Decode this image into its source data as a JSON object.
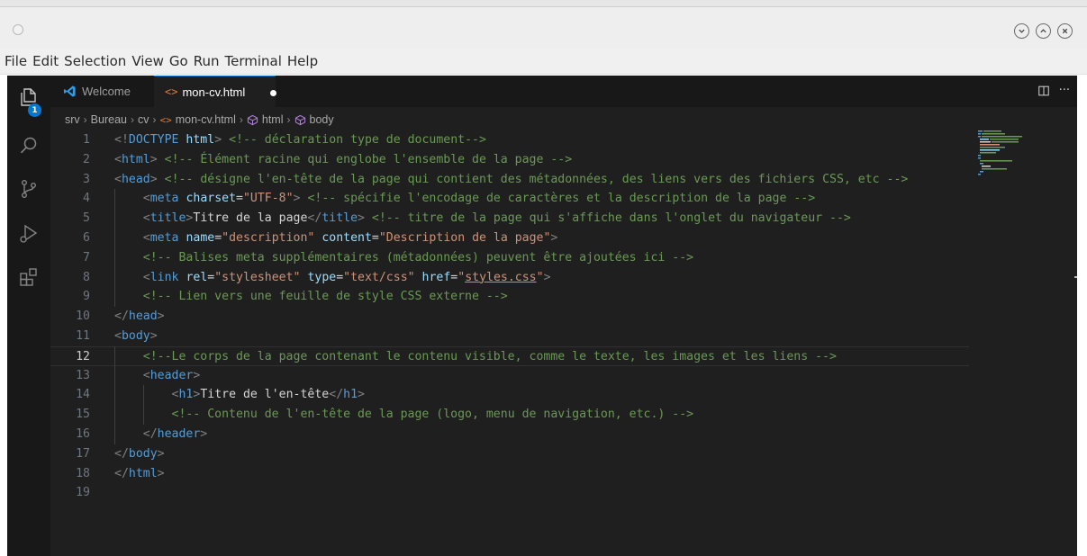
{
  "menubar": {
    "items": [
      "File",
      "Edit",
      "Selection",
      "View",
      "Go",
      "Run",
      "Terminal",
      "Help"
    ]
  },
  "window_controls": {
    "icons": [
      "minimize-icon",
      "maximize-icon",
      "close-icon"
    ]
  },
  "activity_bar": {
    "icons": [
      "explorer-icon",
      "search-icon",
      "source-control-icon",
      "run-debug-icon",
      "extensions-icon"
    ],
    "explorer_badge": "1"
  },
  "tabs": [
    {
      "label": "Welcome",
      "icon": "vscode-logo-icon",
      "active": false
    },
    {
      "label": "mon-cv.html",
      "icon": "html-file-icon",
      "active": true,
      "modified": true
    }
  ],
  "tab_actions": {
    "split_icon": "split-editor-icon",
    "more": "···"
  },
  "breadcrumb": [
    "srv",
    "Bureau",
    "cv",
    "mon-cv.html",
    "html",
    "body"
  ],
  "editor": {
    "current_line": 12,
    "lines": [
      {
        "n": "1",
        "t": "<!DOCTYPE html> <!-- déclaration type de document-->"
      },
      {
        "n": "2",
        "t": "<html> <!-- Élément racine qui englobe l'ensemble de la page -->"
      },
      {
        "n": "3",
        "t": "<head> <!-- désigne l'en-tête de la page qui contient des métadonnées, des liens vers des fichiers CSS, etc -->"
      },
      {
        "n": "4",
        "t": "    <meta charset=\"UTF-8\"> <!-- spécifie l'encodage de caractères et la description de la page -->"
      },
      {
        "n": "5",
        "t": "    <title>Titre de la page</title> <!-- titre de la page qui s'affiche dans l'onglet du navigateur -->"
      },
      {
        "n": "6",
        "t": "    <meta name=\"description\" content=\"Description de la page\">"
      },
      {
        "n": "7",
        "t": "    <!-- Balises meta supplémentaires (métadonnées) peuvent être ajoutées ici -->"
      },
      {
        "n": "8",
        "t": "    <link rel=\"stylesheet\" type=\"text/css\" href=\"styles.css\">"
      },
      {
        "n": "9",
        "t": "    <!-- Lien vers une feuille de style CSS externe -->"
      },
      {
        "n": "10",
        "t": "</head>"
      },
      {
        "n": "11",
        "t": "<body>"
      },
      {
        "n": "12",
        "t": "    <!--Le corps de la page contenant le contenu visible, comme le texte, les images et les liens -->"
      },
      {
        "n": "13",
        "t": "    <header>"
      },
      {
        "n": "14",
        "t": "        <h1>Titre de l'en-tête</h1>"
      },
      {
        "n": "15",
        "t": "        <!-- Contenu de l'en-tête de la page (logo, menu de navigation, etc.) -->"
      },
      {
        "n": "16",
        "t": "    </header>"
      },
      {
        "n": "17",
        "t": "</body>"
      },
      {
        "n": "18",
        "t": "</html>"
      },
      {
        "n": "19",
        "t": ""
      }
    ]
  },
  "colors": {
    "editor_bg": "#1f1f1f",
    "activity_bg": "#181818",
    "accent": "#0078d4",
    "tag": "#569cd6",
    "attribute": "#9cdcfe",
    "string": "#ce9178",
    "comment": "#6a9955"
  }
}
